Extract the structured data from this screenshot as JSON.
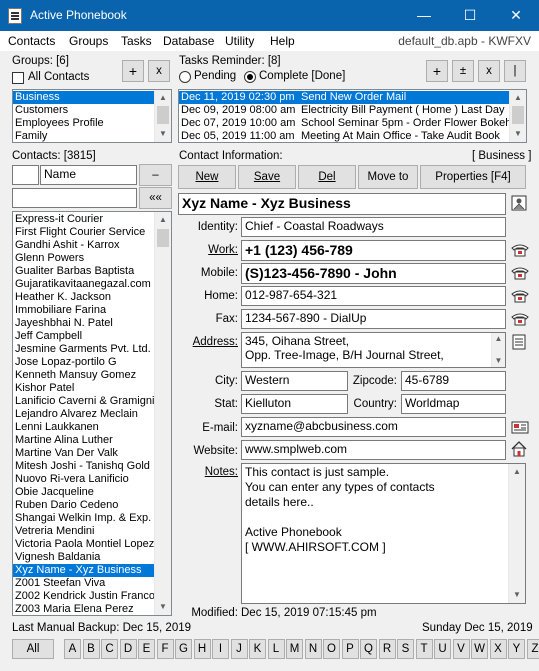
{
  "window": {
    "title": "Active Phonebook",
    "min": "—",
    "max": "☐",
    "close": "✕"
  },
  "menu": {
    "items": [
      "Contacts",
      "Groups",
      "Tasks",
      "Database",
      "Utility",
      "Help"
    ],
    "db_name": "default_db.apb - KWFXV"
  },
  "groups": {
    "label": "Groups: [6]",
    "all_contacts": "All Contacts",
    "add": "+",
    "remove": "x",
    "items": [
      "Business",
      "Customers",
      "Employees Profile",
      "Family"
    ],
    "selected": 0
  },
  "tasks": {
    "label": "Tasks Reminder: [8]",
    "pending": "Pending",
    "complete": "Complete [Done]",
    "add": "+",
    "plusminus": "±",
    "remove": "x",
    "sep": "|",
    "items": [
      {
        "date": "Dec 11, 2019 02:30 pm",
        "text": "Send New Order Mail"
      },
      {
        "date": "Dec 09, 2019 08:00 am",
        "text": "Electricity Bill Payment ( Home ) Last Day"
      },
      {
        "date": "Dec 07, 2019 10:00 am",
        "text": "School Seminar 5pm - Order Flower Bokeh"
      },
      {
        "date": "Dec 05, 2019 11:00 am",
        "text": "Meeting At Main Office - Take Audit Book"
      }
    ],
    "selected": 0
  },
  "contacts": {
    "label": "Contacts: [3815]",
    "sort_field": "Name",
    "minus": "–",
    "back": "««",
    "items": [
      "Express-it Courier",
      "First Flight Courier Service",
      "Gandhi Ashit - Karrox",
      "Glenn Powers",
      "Gualiter Barbas Baptista",
      "Gujaratikavitaanegazal.com",
      "Heather K. Jackson",
      "Immobiliare Farina",
      "Jayeshbhai N. Patel",
      "Jeff Campbell",
      "Jesmine Garments Pvt. Ltd.",
      "Jose Lopaz-portilo G",
      "Kenneth Mansuy Gomez",
      "Kishor Patel",
      "Lanificio Caverni & Gramigni",
      "Lejandro Alvarez Meclain",
      "Lenni Laukkanen",
      "Martine Alina Luther",
      "Martine Van Der Valk",
      "Mitesh Joshi - Tanishq Gold",
      "Nuovo Ri-vera Lanificio",
      "Obie Jacqueline",
      "Ruben Dario Cedeno",
      "Shangai Welkin Imp. & Exp.",
      "Vetreria Mendini",
      "Victoria Paola Montiel Lopez",
      "Vignesh Baldania",
      "Xyz Name - Xyz Business",
      "Z001 Steefan Viva",
      "Z002 Kendrick Justin Franco",
      "Z003 Maria Elena Perez"
    ],
    "selected": 27
  },
  "info": {
    "label": "Contact Information:",
    "group": "[ Business ]",
    "buttons": {
      "new": "New",
      "save": "Save",
      "del": "Del",
      "moveto": "Move to",
      "properties": "Properties [F4]"
    },
    "name": "Xyz Name - Xyz Business",
    "identity_label": "Identity:",
    "identity": "Chief - Coastal Roadways",
    "work_label": "Work:",
    "work": "+1 (123) 456-789",
    "mobile_label": "Mobile:",
    "mobile": "(S)123-456-7890 - John",
    "home_label": "Home:",
    "home": "012-987-654-321",
    "fax_label": "Fax:",
    "fax": "1234-567-890 - DialUp",
    "address_label": "Address:",
    "address1": "345, Oihana Street,",
    "address2": "Opp. Tree-Image, B/H Journal Street,",
    "city_label": "City:",
    "city": "Western",
    "zip_label": "Zipcode:",
    "zip": "45-6789",
    "stat_label": "Stat:",
    "stat": "Kielluton",
    "country_label": "Country:",
    "country": "Worldmap",
    "email_label": "E-mail:",
    "email": "xyzname@abcbusiness.com",
    "website_label": "Website:",
    "website": "www.smplweb.com",
    "notes_label": "Notes:",
    "notes": [
      "This contact is just sample.",
      "You can enter any types of contacts",
      "details here..",
      "",
      "Active Phonebook",
      "[ WWW.AHIRSOFT.COM ]"
    ],
    "modified_label": "Modified:",
    "modified": "Dec 15, 2019 07:15:45 pm"
  },
  "status": {
    "backup": "Last Manual Backup: Dec 15, 2019",
    "today": "Sunday Dec 15, 2019"
  },
  "alphabet": [
    "All",
    "A",
    "B",
    "C",
    "D",
    "E",
    "F",
    "G",
    "H",
    "I",
    "J",
    "K",
    "L",
    "M",
    "N",
    "O",
    "P",
    "Q",
    "R",
    "S",
    "T",
    "U",
    "V",
    "W",
    "X",
    "Y",
    "Z"
  ],
  "colors": {
    "titlebar": "#0a64ad",
    "selection": "#0078d7"
  }
}
